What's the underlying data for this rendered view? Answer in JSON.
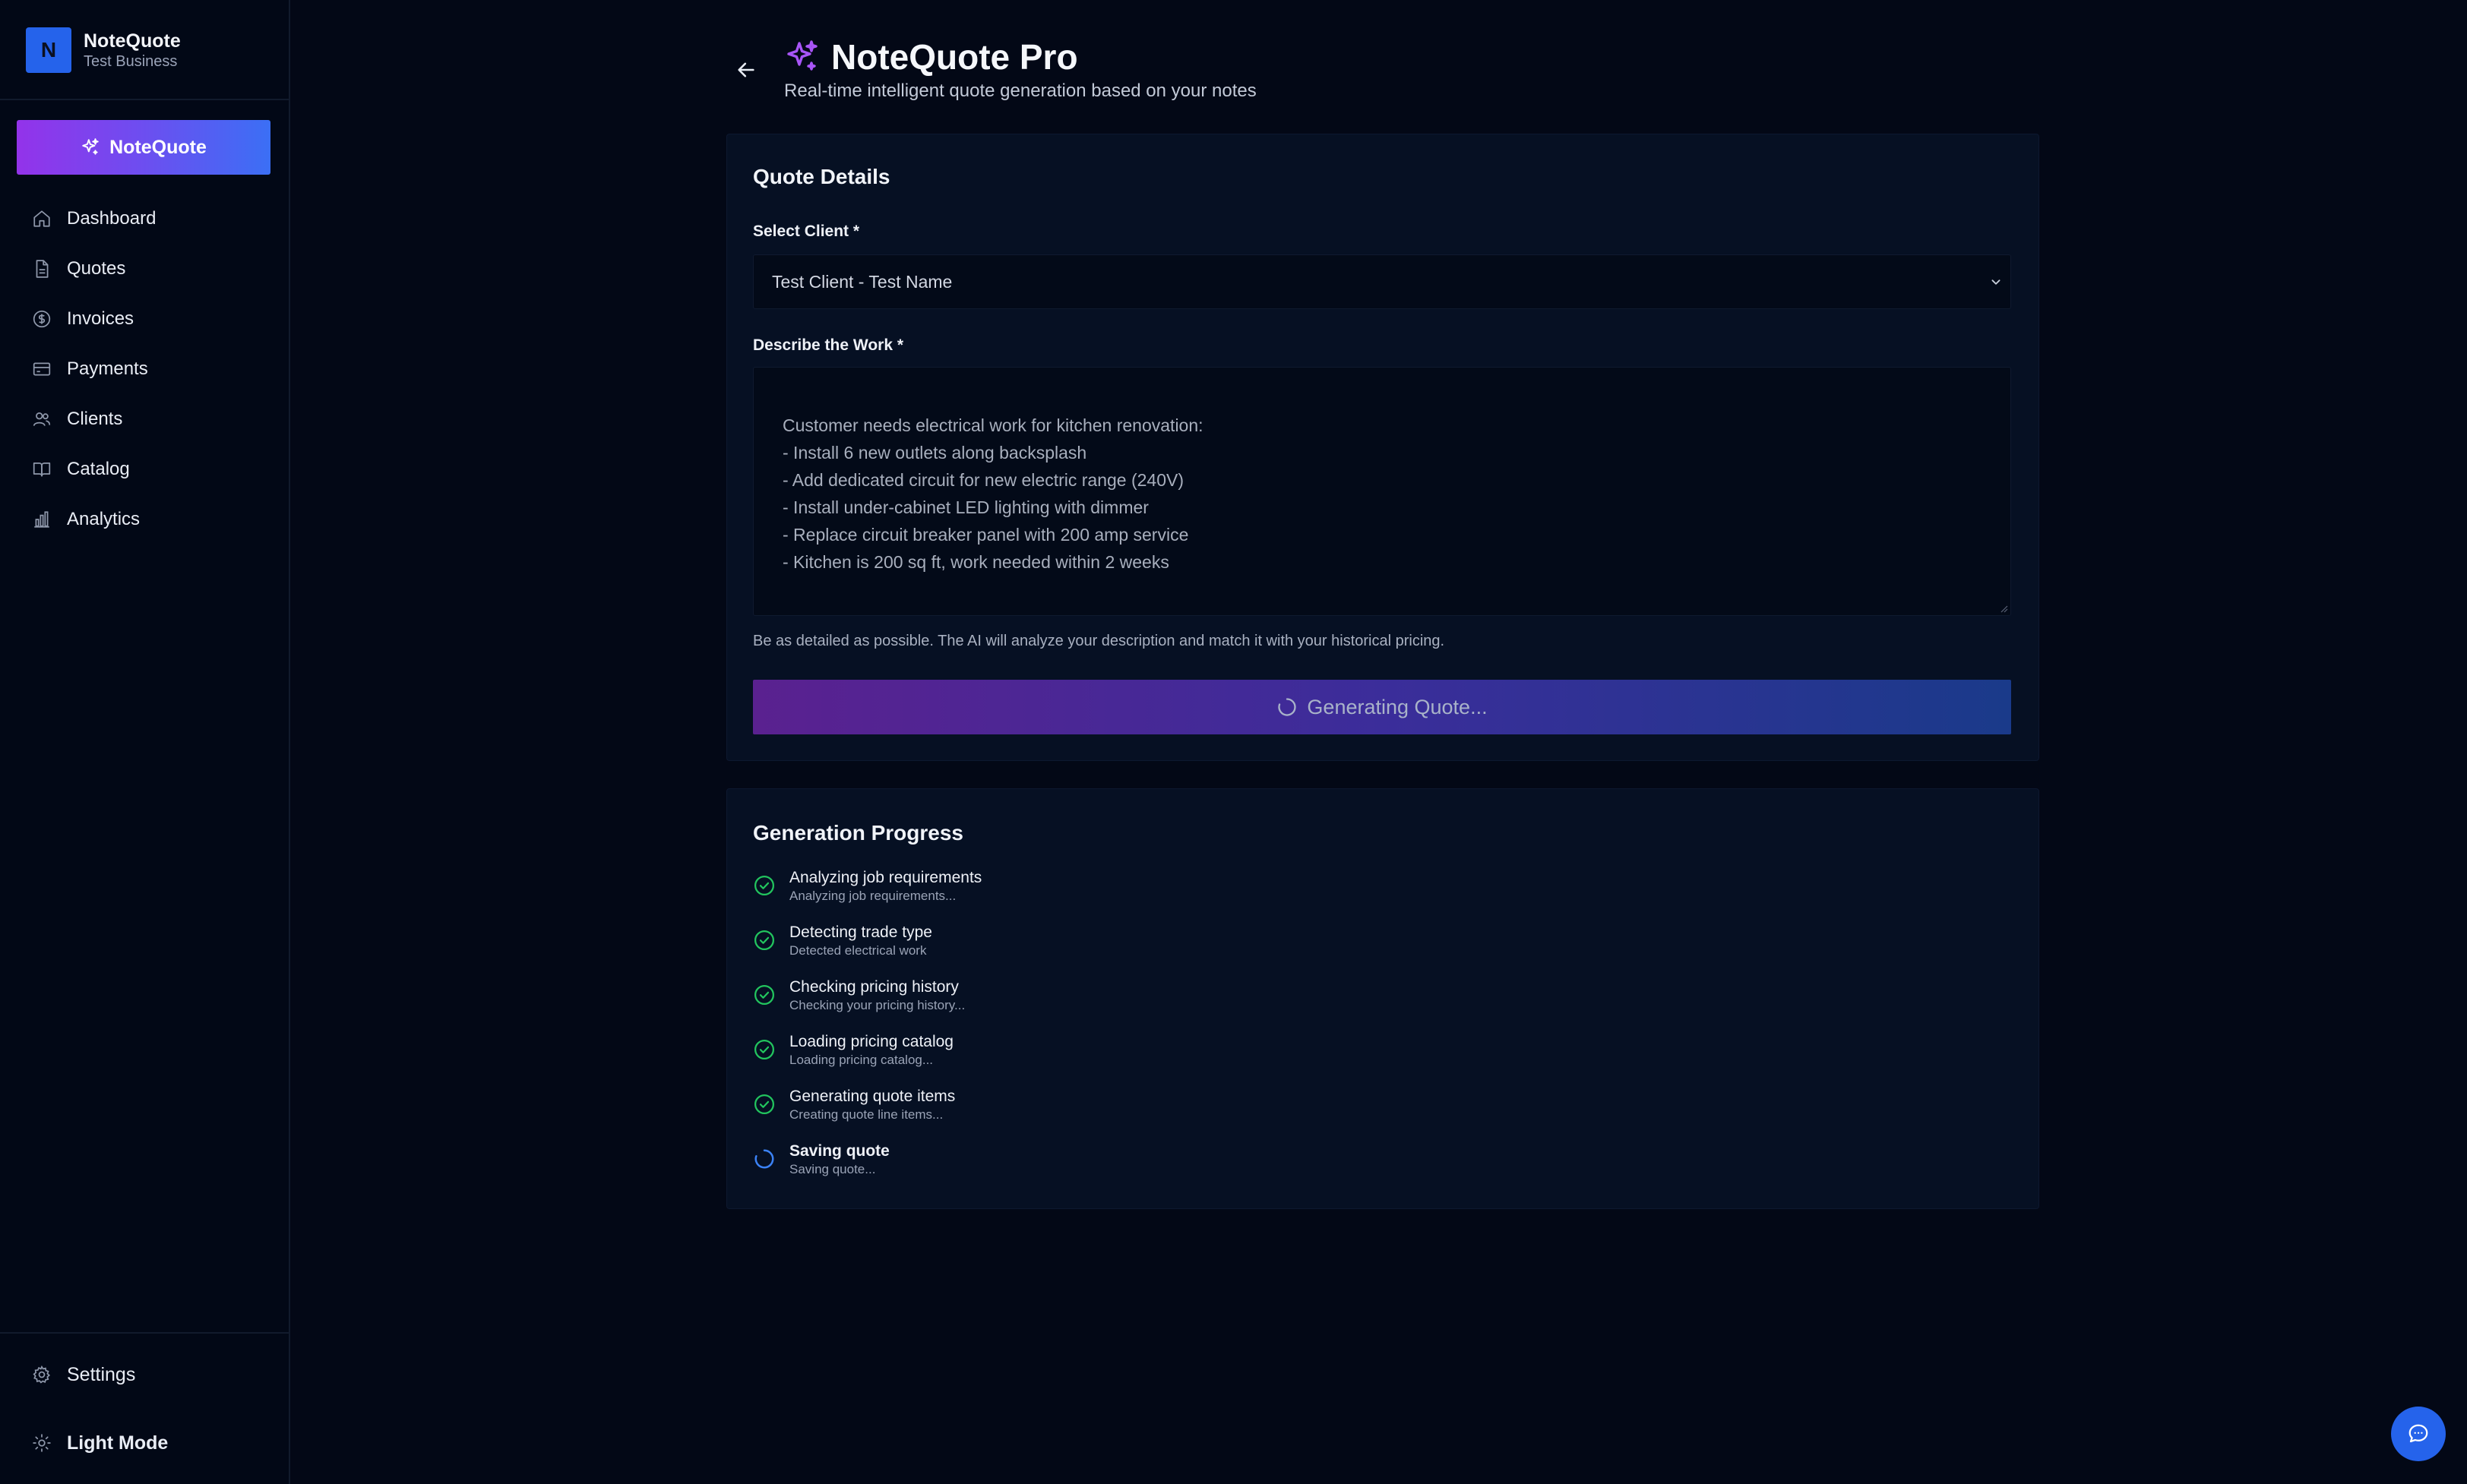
{
  "brand": {
    "logo_letter": "N",
    "name": "NoteQuote",
    "business": "Test Business"
  },
  "sidebar": {
    "primary_button": "NoteQuote",
    "items": [
      {
        "label": "Dashboard",
        "icon": "home-icon"
      },
      {
        "label": "Quotes",
        "icon": "file-icon"
      },
      {
        "label": "Invoices",
        "icon": "dollar-icon"
      },
      {
        "label": "Payments",
        "icon": "credit-card-icon"
      },
      {
        "label": "Clients",
        "icon": "users-icon"
      },
      {
        "label": "Catalog",
        "icon": "book-icon"
      },
      {
        "label": "Analytics",
        "icon": "bar-chart-icon"
      }
    ],
    "settings": "Settings",
    "theme_toggle": "Light Mode"
  },
  "header": {
    "title": "NoteQuote Pro",
    "subtitle": "Real-time intelligent quote generation based on your notes"
  },
  "quote_details": {
    "title": "Quote Details",
    "client_label": "Select Client *",
    "client_value": "Test Client - Test Name",
    "work_label": "Describe the Work *",
    "work_text": "Customer needs electrical work for kitchen renovation:\n- Install 6 new outlets along backsplash\n- Add dedicated circuit for new electric range (240V)\n- Install under-cabinet LED lighting with dimmer\n- Replace circuit breaker panel with 200 amp service\n- Kitchen is 200 sq ft, work needed within 2 weeks",
    "helper": "Be as detailed as possible. The AI will analyze your description and match it with your historical pricing.",
    "generate_button": "Generating Quote..."
  },
  "progress": {
    "title": "Generation Progress",
    "steps": [
      {
        "title": "Analyzing job requirements",
        "desc": "Analyzing job requirements...",
        "status": "done"
      },
      {
        "title": "Detecting trade type",
        "desc": "Detected electrical work",
        "status": "done"
      },
      {
        "title": "Checking pricing history",
        "desc": "Checking your pricing history...",
        "status": "done"
      },
      {
        "title": "Loading pricing catalog",
        "desc": "Loading pricing catalog...",
        "status": "done"
      },
      {
        "title": "Generating quote items",
        "desc": "Creating quote line items...",
        "status": "done"
      },
      {
        "title": "Saving quote",
        "desc": "Saving quote...",
        "status": "in-progress"
      }
    ]
  },
  "colors": {
    "background": "#030816",
    "accent_blue": "#2563eb",
    "accent_purple": "#9333ea",
    "success_green": "#22c55e"
  }
}
